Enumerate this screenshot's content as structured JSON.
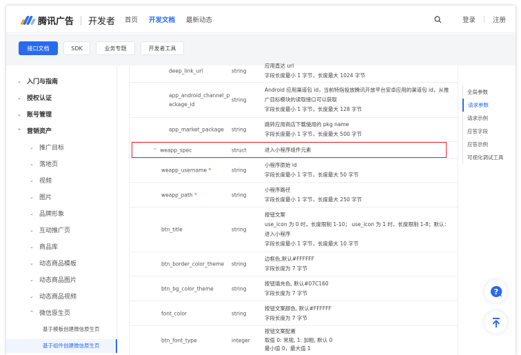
{
  "header": {
    "brand": "腾讯广告",
    "brand_sub": "开发者",
    "nav": [
      "首页",
      "开发文档",
      "最新动态"
    ],
    "login": "登录",
    "register": "注册"
  },
  "subnav": [
    "接口文档",
    "SDK",
    "业务专题",
    "开发者工具"
  ],
  "sidebar": {
    "items": [
      "入门与指南",
      "授权认证",
      "账号管理",
      "营销资产",
      "推广目标",
      "落地页",
      "视频",
      "图片",
      "品牌形象",
      "互动推广页",
      "商品库",
      "动态商品模板",
      "动态商品图片",
      "动态商品视频",
      "微信原生页",
      "基于模板创建微信原生页",
      "基于组件创建微信原生页"
    ]
  },
  "table": {
    "rows": [
      {
        "name": "deep_link_url",
        "type": "string",
        "desc": [
          "应用直达 url",
          "字段长度最小 1 字节，长度最大 1024 字节"
        ]
      },
      {
        "name": "app_android_channel_p ackage_id",
        "type": "string",
        "desc": [
          "Android 应用渠道包 id，当前特指投放腾讯开放平台安卓应用的渠道包 id，从推广目标模块的读取接口可以获取",
          "字段长度最小 1 字节，长度最大 128 字节"
        ]
      },
      {
        "name": "app_market_package",
        "type": "string",
        "desc": [
          "跳转应用商店下载使用的 pkg name",
          "字段长度最小 1 字节，长度最大 500 字节"
        ]
      },
      {
        "name": "weapp_spec",
        "type": "struct",
        "desc": [
          "进入小程序组件元素"
        ]
      },
      {
        "name": "weapp_username",
        "required": "*",
        "type": "string",
        "desc": [
          "小程序原始 id",
          "字段长度最小 1 字节，长度最大 50 字节"
        ]
      },
      {
        "name": "weapp_path",
        "required": "*",
        "type": "string",
        "desc": [
          "小程序路径",
          "字段长度最小 1 字节，长度最大 250 字节"
        ]
      },
      {
        "name": "btn_title",
        "type": "string",
        "desc": [
          "按钮文案",
          "use_icon 为 0 时，长度限制 1-10； use_icon 为 1 时，长度限制 1-8；默认：进入小程序",
          "字段长度最小 1 字节，长度最大 10 字节"
        ]
      },
      {
        "name": "btn_border_color_theme",
        "type": "string",
        "desc": [
          "边框色,默认#FFFFFF",
          "字段长度为 7 字节"
        ]
      },
      {
        "name": "btn_bg_color_theme",
        "type": "string",
        "desc": [
          "按钮填充色, 默认#07C160",
          "字段长度为 7 字节"
        ]
      },
      {
        "name": "font_color",
        "type": "string",
        "desc": [
          "按钮文案颜色, 默认#FFFFFF",
          "字段长度为 7 字节"
        ]
      },
      {
        "name": "btn_font_type",
        "type": "integer",
        "desc": [
          "按钮文案配置",
          "取值 0: 常规, 1: 加粗, 默认 0",
          "最小值 0，最大值 1"
        ]
      }
    ]
  },
  "toc": [
    "全局参数",
    "请求参数",
    "请求示例",
    "应答字段",
    "应答示例",
    "可视化调试工具"
  ]
}
